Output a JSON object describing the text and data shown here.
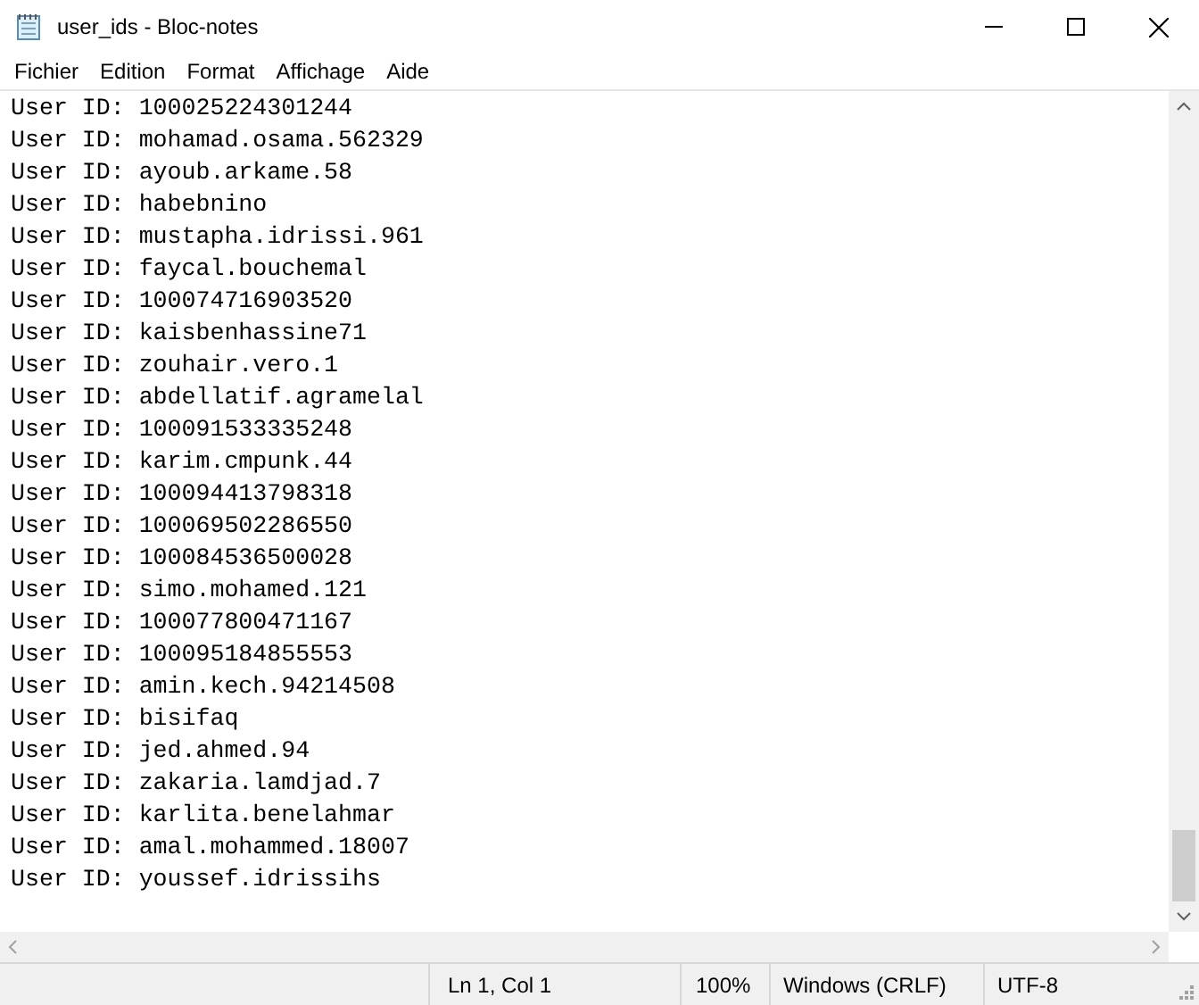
{
  "window": {
    "title": "user_ids - Bloc-notes"
  },
  "menu": [
    "Fichier",
    "Edition",
    "Format",
    "Affichage",
    "Aide"
  ],
  "lines": [
    "User ID: 100025224301244",
    "User ID: mohamad.osama.562329",
    "User ID: ayoub.arkame.58",
    "User ID: habebnino",
    "User ID: mustapha.idrissi.961",
    "User ID: faycal.bouchemal",
    "User ID: 100074716903520",
    "User ID: kaisbenhassine71",
    "User ID: zouhair.vero.1",
    "User ID: abdellatif.agramelal",
    "User ID: 100091533335248",
    "User ID: karim.cmpunk.44",
    "User ID: 100094413798318",
    "User ID: 100069502286550",
    "User ID: 100084536500028",
    "User ID: simo.mohamed.121",
    "User ID: 100077800471167",
    "User ID: 100095184855553",
    "User ID: amin.kech.94214508",
    "User ID: bisifaq",
    "User ID: jed.ahmed.94",
    "User ID: zakaria.lamdjad.7",
    "User ID: karlita.benelahmar",
    "User ID: amal.mohammed.18007",
    "User ID: youssef.idrissihs"
  ],
  "status_bar": {
    "position": "Ln 1, Col 1",
    "zoom": "100%",
    "line_endings": "Windows (CRLF)",
    "encoding": "UTF-8"
  }
}
